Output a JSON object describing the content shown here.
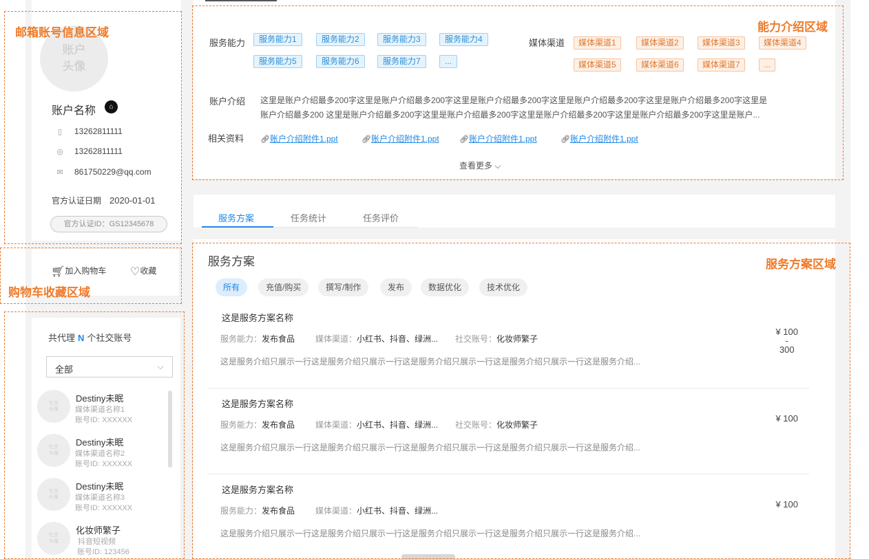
{
  "annotations": {
    "account_area": "邮箱账号信息区域",
    "cart_area": "购物车收藏区域",
    "ability_area": "能力介绍区域",
    "plan_area": "服务方案区域"
  },
  "profile": {
    "avatar_text": "账户头像",
    "avatar_line1": "账户",
    "avatar_line2": "头像",
    "name": "账户名称",
    "phone": "13262811111",
    "wechat": "13262811111",
    "email": "861750229@qq.com",
    "cert_date_label": "官方认证日期",
    "cert_date": "2020-01-01",
    "cert_id": "官方认证ID：GS12345678"
  },
  "actions": {
    "cart": "加入购物车",
    "favorite": "收藏"
  },
  "agents": {
    "title_prefix": "共代理",
    "count": "N",
    "title_suffix": "个社交账号",
    "filter_value": "全部",
    "avatar_text_1": "社交",
    "avatar_text_2": "头像",
    "items": [
      {
        "name": "Destiny未眠",
        "channel": "媒体渠道名称1",
        "id": "账号ID: XXXXXX"
      },
      {
        "name": "Destiny未眠",
        "channel": "媒体渠道名称2",
        "id": "账号ID: XXXXXX"
      },
      {
        "name": "Destiny未眠",
        "channel": "媒体渠道名称3",
        "id": "账号ID: XXXXXX"
      },
      {
        "name": "化妆师繁子",
        "channel": "抖音短视频",
        "id": "账号ID: 123456"
      }
    ]
  },
  "ability": {
    "service_label": "服务能力",
    "services": [
      "服务能力1",
      "服务能力2",
      "服务能力3",
      "服务能力4",
      "服务能力5",
      "服务能力6",
      "服务能力7",
      "..."
    ],
    "media_label": "媒体渠道",
    "media": [
      "媒体渠道1",
      "媒体渠道2",
      "媒体渠道3",
      "媒体渠道4",
      "媒体渠道5",
      "媒体渠道6",
      "媒体渠道7",
      "..."
    ],
    "intro_label": "账户介绍",
    "intro_line1": "这里是账户介绍最多200字这里是账户介绍最多200字这里是账户介绍最多200字这里是账户介绍最多200字这里是账户介绍最多200字这里是",
    "intro_line2": "账户介绍最多200 这里是账户介绍最多200字这里是账户介绍最多200字这里是账户介绍最多200字这里是账户介绍最多200字这里是账户...",
    "docs_label": "相关资料",
    "docs": [
      "账户介绍附件1.ppt",
      "账户介绍附件1.ppt",
      "账户介绍附件1.ppt",
      "账户介绍附件1.ppt"
    ],
    "more": "查看更多"
  },
  "tabs": [
    "服务方案",
    "任务统计",
    "任务评价"
  ],
  "plans": {
    "title": "服务方案",
    "filters": [
      "所有",
      "充值/购买",
      "撰写/制作",
      "发布",
      "数据优化",
      "技术优化"
    ],
    "service_label": "服务能力：",
    "media_label": "媒体渠道：",
    "social_label": "社交账号：",
    "items": [
      {
        "name": "这是服务方案名称",
        "service": "发布食品",
        "media": "小红书、抖音、绿洲...",
        "social": "化妆师繁子",
        "desc": "这是服务介绍只展示一行这是服务介绍只展示一行这是服务介绍只展示一行这是服务介绍只展示一行这是服务介绍...",
        "price": "¥ 100",
        "price_dash": "-",
        "price_high": "300"
      },
      {
        "name": "这是服务方案名称",
        "service": "发布食品",
        "media": "小红书、抖音、绿洲...",
        "social": "化妆师繁子",
        "desc": "这是服务介绍只展示一行这是服务介绍只展示一行这是服务介绍只展示一行这是服务介绍只展示一行这是服务介绍...",
        "price": "¥ 100"
      },
      {
        "name": "这是服务方案名称",
        "service": "发布食品",
        "media": "小红书、抖音、绿洲...",
        "desc": "这是服务介绍只展示一行这是服务介绍只展示一行这是服务介绍只展示一行这是服务介绍只展示一行这是服务介绍...",
        "price": "¥ 100"
      }
    ]
  },
  "colors": {
    "accent": "#1e88e5",
    "annotation": "#ee7b2a",
    "tag_orange": "#e0782e"
  }
}
